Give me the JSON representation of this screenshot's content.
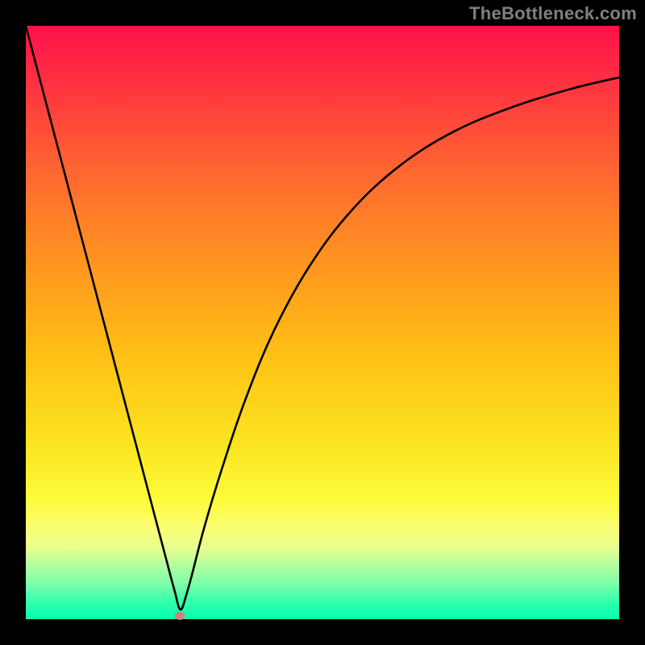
{
  "attribution": "TheBottleneck.com",
  "colors": {
    "page_bg": "#000000",
    "text": "#808080",
    "curve": "#000000",
    "dot": "#d47f7d",
    "gradient_top": "#ff114b",
    "gradient_bottom": "#06ffae"
  },
  "chart_data": {
    "type": "line",
    "title": "",
    "xlabel": "",
    "ylabel": "",
    "xlim": [
      0,
      100
    ],
    "ylim": [
      0,
      100
    ],
    "x": [
      0,
      3,
      6,
      9,
      12,
      15,
      18,
      20,
      22,
      23.5,
      24.5,
      25.2,
      25.8,
      26.3,
      27,
      28,
      30,
      33,
      37,
      42,
      48,
      55,
      63,
      72,
      82,
      92,
      100
    ],
    "values": [
      100,
      88.6,
      77.2,
      65.8,
      54.4,
      43.0,
      31.6,
      24.0,
      16.4,
      10.7,
      6.9,
      4.3,
      2.0,
      1.8,
      3.9,
      7.5,
      15.2,
      25.2,
      37.0,
      49.0,
      59.8,
      69.0,
      76.4,
      82.1,
      86.3,
      89.4,
      91.3
    ],
    "marker": {
      "x": 26.0,
      "y": 0.6
    },
    "legend": false,
    "grid": false
  }
}
